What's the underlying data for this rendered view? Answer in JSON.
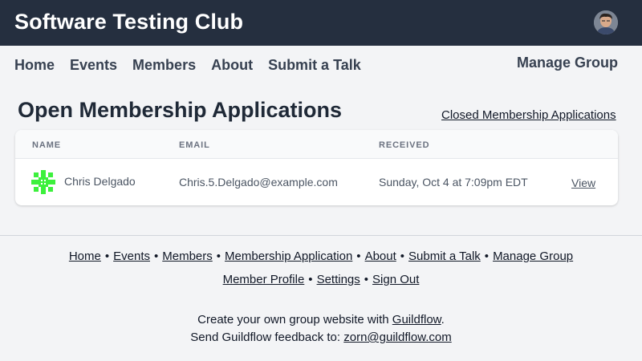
{
  "header": {
    "site_title": "Software Testing Club",
    "avatar_icon": "user-avatar"
  },
  "nav": {
    "items": [
      "Home",
      "Events",
      "Members",
      "About",
      "Submit a Talk"
    ],
    "manage_group": "Manage Group"
  },
  "page": {
    "title": "Open Membership Applications",
    "closed_link": "Closed Membership Applications"
  },
  "table": {
    "columns": [
      "NAME",
      "EMAIL",
      "RECEIVED"
    ],
    "rows": [
      {
        "icon": "identicon",
        "name": "Chris Delgado",
        "email": "Chris.5.Delgado@example.com",
        "received": "Sunday, Oct 4 at 7:09pm EDT",
        "action": "View"
      }
    ]
  },
  "footer": {
    "links_row1": [
      "Home",
      "Events",
      "Members",
      "Membership Application",
      "About",
      "Submit a Talk",
      "Manage Group"
    ],
    "links_row2": [
      "Member Profile",
      "Settings",
      "Sign Out"
    ],
    "separator": "•",
    "create_text": "Create your own group website with",
    "create_link": "Guildflow",
    "create_suffix": ".",
    "feedback_text": "Send Guildflow feedback to:",
    "feedback_link": "zorn@guildflow.com"
  },
  "colors": {
    "header_bg": "#252f3f",
    "page_bg": "#f3f4f6",
    "identicon": "#3cf03c"
  }
}
